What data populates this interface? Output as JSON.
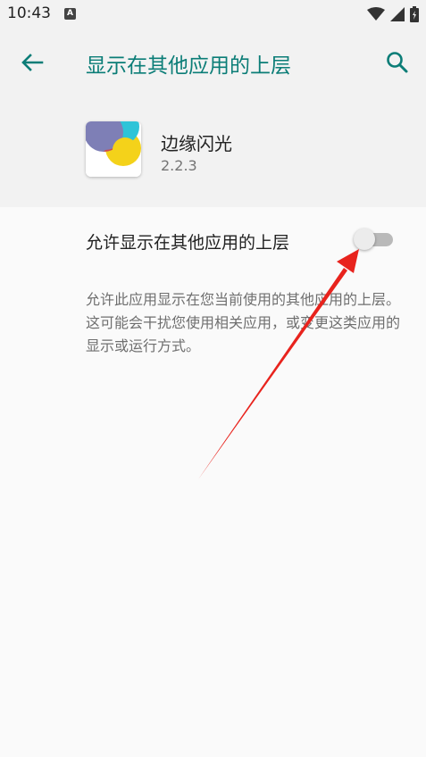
{
  "status_bar": {
    "time": "10:43",
    "notification_icon": "a-icon",
    "wifi_icon": "wifi-icon",
    "signal_icon": "signal-icon",
    "battery_icon": "battery-icon"
  },
  "app_bar": {
    "title": "显示在其他应用的上层",
    "back_icon": "arrow-left-icon",
    "search_icon": "search-icon",
    "accent_color": "#0b7d77"
  },
  "app_info": {
    "name": "边缘闪光",
    "version": "2.2.3"
  },
  "setting": {
    "label": "允许显示在其他应用的上层",
    "enabled": false,
    "description": "允许此应用显示在您当前使用的其他应用的上层。这可能会干扰您使用相关应用，或变更这类应用的显示或运行方式。"
  },
  "annotation": {
    "arrow_color": "#e8231d"
  }
}
